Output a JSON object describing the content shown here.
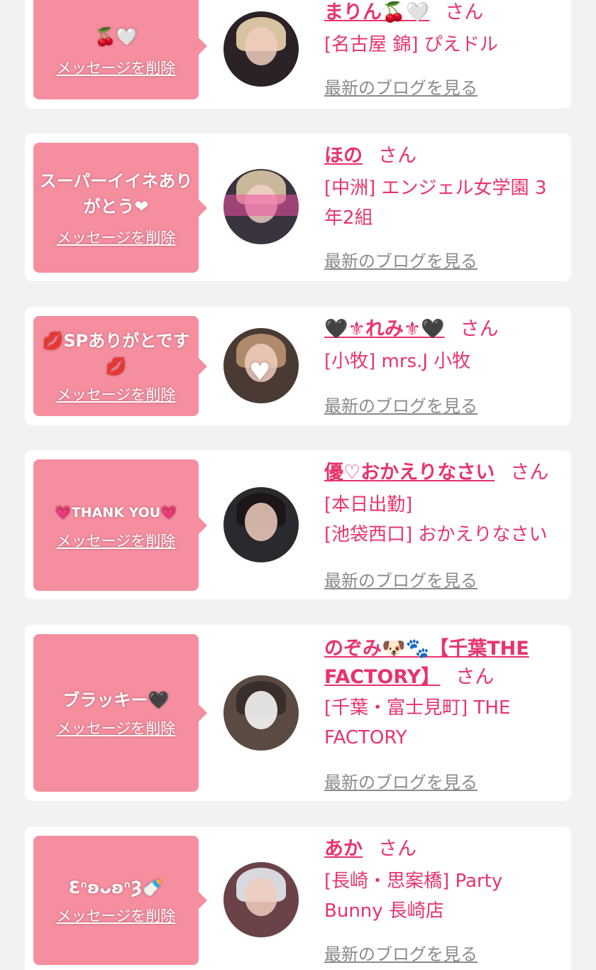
{
  "san_label": "さん",
  "delete_label": "メッセージを削除",
  "blog_label": "最新のブログを見る",
  "colors": {
    "page_bg": "#f2f2f2",
    "card_bg": "#ffffff",
    "bubble_bg": "#f58fa0",
    "name_pink": "#e8336d",
    "link_gray": "#8a8a8a"
  },
  "items": [
    {
      "message": "🍒🤍",
      "name": "まりん🍒🤍",
      "shop_lines": [
        "[名古屋 錦] ぴえドル"
      ]
    },
    {
      "message": "スーパーイイネありがとう❤",
      "name": "ほの",
      "shop_lines": [
        "[中洲] エンジェル女学園 3年2組"
      ]
    },
    {
      "message": "💋SPありがとです💋",
      "name": "🖤⚜れみ⚜🖤",
      "shop_lines": [
        "[小牧] mrs.J 小牧"
      ]
    },
    {
      "message": "💗THANK YOU💗",
      "name": "優♡おかえりなさい",
      "shop_lines": [
        "[本日出勤]",
        "[池袋西口] おかえりなさい"
      ]
    },
    {
      "message": "ブラッキー🖤",
      "name": "のぞみ🐶🐾【千葉THE FACTORY】",
      "shop_lines": [
        "[千葉・富士見町] THE FACTORY"
      ]
    },
    {
      "message": "ƐᐢʚᴗʚᐢȜ🍼",
      "name": "あか",
      "shop_lines": [
        "[長崎・思案橋] Party Bunny 長崎店"
      ]
    }
  ]
}
